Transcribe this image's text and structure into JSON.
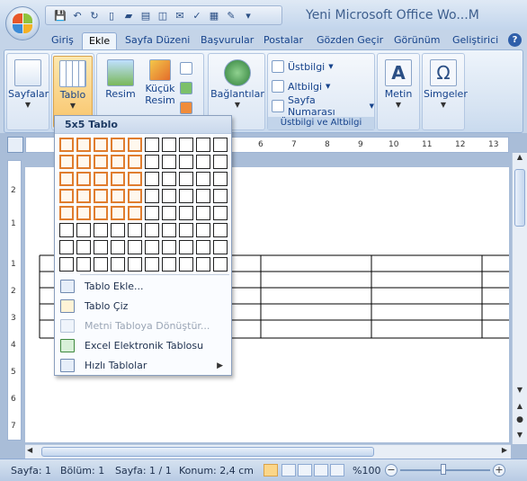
{
  "window": {
    "title": "Yeni Microsoft Office Wo...M"
  },
  "ribbon_tabs": [
    {
      "label": "Giriş"
    },
    {
      "label": "Ekle",
      "active": true
    },
    {
      "label": "Sayfa Düzeni"
    },
    {
      "label": "Başvurular"
    },
    {
      "label": "Postalar"
    },
    {
      "label": "Gözden Geçir"
    },
    {
      "label": "Görünüm"
    },
    {
      "label": "Geliştirici"
    }
  ],
  "ribbon": {
    "sayfalar": "Sayfalar",
    "tablo": "Tablo",
    "resim": "Resim",
    "kucuk_resim": "Küçük Resim",
    "baglantilar": "Bağlantılar",
    "ustbilgi": "Üstbilgi",
    "altbilgi": "Altbilgi",
    "sayfa_numarasi": "Sayfa Numarası",
    "ustbilgi_group": "Üstbilgi ve Altbilgi",
    "metin": "Metin",
    "simgeler": "Simgeler"
  },
  "table_dropdown": {
    "header": "5x5 Tablo",
    "grid_rows": 8,
    "grid_cols": 10,
    "selected_rows": 5,
    "selected_cols": 5,
    "items": [
      {
        "label": "Tablo Ekle...",
        "icon": "insert-table-icon",
        "enabled": true
      },
      {
        "label": "Tablo Çiz",
        "icon": "draw-table-icon",
        "enabled": true
      },
      {
        "label": "Metni Tabloya Dönüştür...",
        "icon": "convert-text-icon",
        "enabled": false
      },
      {
        "label": "Excel Elektronik Tablosu",
        "icon": "excel-icon",
        "enabled": true
      },
      {
        "label": "Hızlı Tablolar",
        "icon": "quick-tables-icon",
        "enabled": true,
        "submenu": true
      }
    ]
  },
  "ruler": {
    "h_numbers": [
      "6",
      "7",
      "8",
      "9",
      "10",
      "11",
      "12",
      "13"
    ],
    "v_numbers": [
      "2",
      "1",
      "1",
      "2",
      "3",
      "4",
      "5",
      "6",
      "7"
    ]
  },
  "status_bar": {
    "page": "Sayfa: 1",
    "section": "Bölüm: 1",
    "pages": "Sayfa: 1 / 1",
    "position": "Konum: 2,4 cm",
    "zoom": "%100"
  }
}
